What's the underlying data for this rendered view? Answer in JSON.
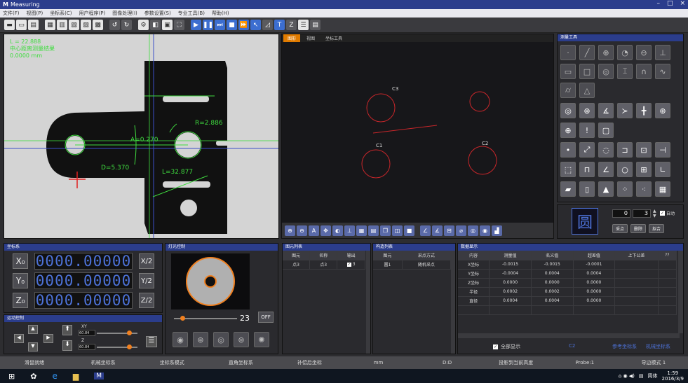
{
  "window": {
    "title": "Measuring",
    "logo": "M",
    "minimize": "–",
    "maximize": "□",
    "close": "×"
  },
  "menu": [
    "文件(F)",
    "视图(P)",
    "坐标系(C)",
    "用户程序(P)",
    "图像处理(I)",
    "参数设置(S)",
    "专业工具(B)",
    "帮助(H)"
  ],
  "camera": {
    "readout": [
      "L = 22.888",
      "中心距离测量结果",
      "0.0000 mm"
    ],
    "labels": {
      "r": "R=2.886",
      "a": "A=0.270",
      "d": "D=5.370",
      "l": "L=32.877"
    }
  },
  "cad": {
    "tabs": [
      "图形",
      "视图",
      "坐标工具"
    ],
    "labels": {
      "c1": "C1",
      "c2": "C2",
      "c3": "C3"
    }
  },
  "tools": {
    "title": "测量工具"
  },
  "shape": {
    "name": "圆",
    "count_a": "0",
    "count_b": "3",
    "auto_label": "自动",
    "btn_sample": "采点",
    "btn_delete": "删除",
    "btn_fit": "拟合"
  },
  "coords": {
    "title": "坐标系",
    "rows": [
      {
        "axis": "X₀",
        "value": "0000.00000",
        "half": "X/2"
      },
      {
        "axis": "Y₀",
        "value": "0000.00000",
        "half": "Y/2"
      },
      {
        "axis": "Z₀",
        "value": "0000.00000",
        "half": "Z/2"
      }
    ]
  },
  "motion": {
    "title": "运动控制",
    "xy_label": "XY",
    "xy_value": "60.84",
    "z_label": "Z",
    "z_value": "60.84"
  },
  "light": {
    "title": "灯光控制",
    "level": "23",
    "off_label": "OFF"
  },
  "features": {
    "title": "图元列表",
    "headers": [
      "图元",
      "名称",
      "输出"
    ],
    "rows": [
      {
        "type": "点3",
        "name": "点3",
        "output": "3"
      }
    ]
  },
  "construct": {
    "title": "构造列表",
    "headers": [
      "图元",
      "采点方式"
    ],
    "rows": [
      {
        "type": "圆1",
        "method": "随机采点"
      }
    ]
  },
  "data": {
    "title": "数据显示",
    "headers": [
      "内容",
      "测量值",
      "名义值",
      "超差值",
      "上下公差",
      "??"
    ],
    "rows": [
      {
        "item": "X坐标",
        "measured": "-0.0015",
        "nominal": "-0.0015",
        "error": "-0.0001"
      },
      {
        "item": "Y坐标",
        "measured": "-0.0004",
        "nominal": "0.0004",
        "error": "0.0004"
      },
      {
        "item": "Z坐标",
        "measured": "0.0000",
        "nominal": "0.0000",
        "error": "0.0000"
      },
      {
        "item": "半径",
        "measured": "0.0002",
        "nominal": "0.0002",
        "error": "0.0000"
      },
      {
        "item": "直径",
        "measured": "0.0004",
        "nominal": "0.0004",
        "error": "0.0000"
      }
    ],
    "show_all": "全部显示",
    "current": "C2",
    "ref_coords": "参考坐标系",
    "machine_coords": "机械坐标系"
  },
  "status": [
    "滑鼠就绪",
    "机械坐标系",
    "坐标系模式",
    "直角坐标系",
    "补偿后坐标",
    "mm",
    "D:D",
    "投影到当前高度",
    "Probe:1",
    "导边模式 1"
  ],
  "taskbar": {
    "ime": "简体",
    "time": "1:59",
    "date": "2016/3/9"
  },
  "colors": {
    "accent": "#2b3d8c",
    "digits": "#4d72d8",
    "cad_circle": "#c8262a",
    "measure_green": "#3fdc3f",
    "tab_active": "#e07b00"
  }
}
